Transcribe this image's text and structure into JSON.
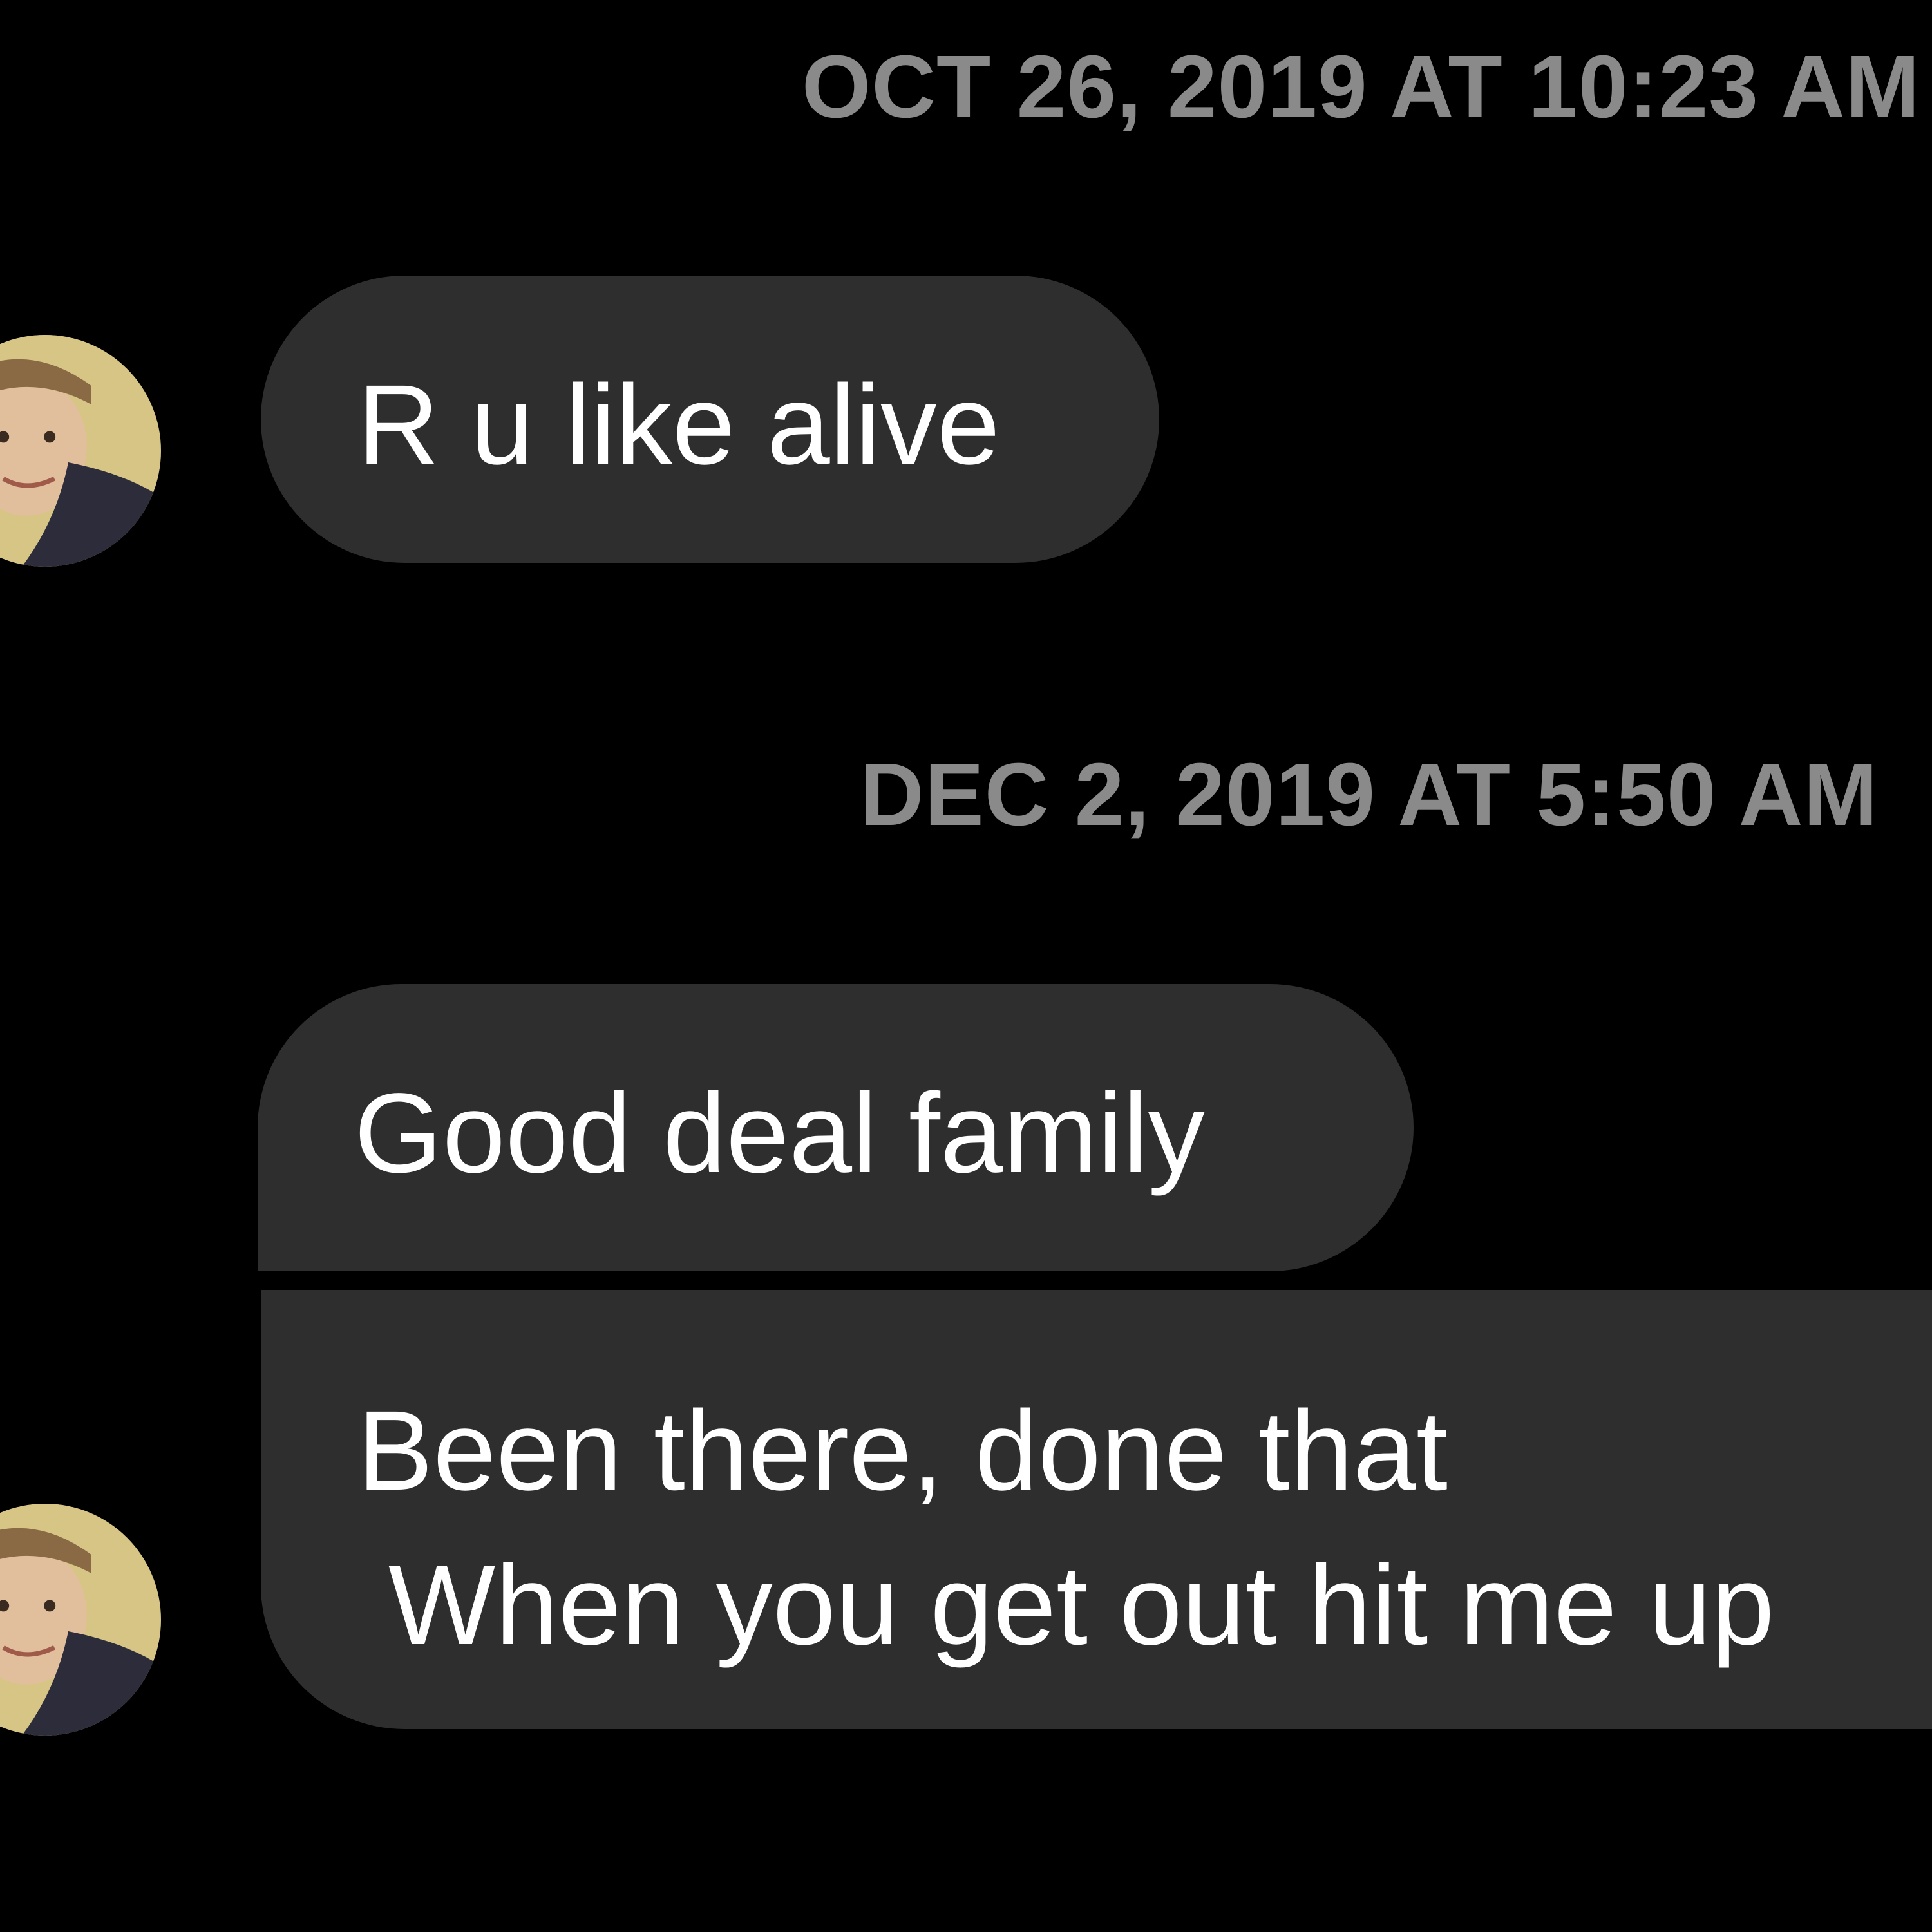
{
  "conversation": {
    "timestamps": [
      "OCT 26, 2019 AT 10:23 AM",
      "DEC 2, 2019 AT 5:50 AM"
    ],
    "messages": [
      {
        "lines": [
          "R u like alive"
        ]
      },
      {
        "lines": [
          "Good deal family"
        ]
      },
      {
        "lines": [
          "Been there, done that",
          "When you get out hit me up"
        ]
      }
    ]
  },
  "colors": {
    "background": "#000000",
    "bubble": "#2e2e2e",
    "timestamp": "#8a8a8a",
    "text": "#ffffff"
  },
  "icons": {
    "avatar": "contact-avatar-photo"
  }
}
